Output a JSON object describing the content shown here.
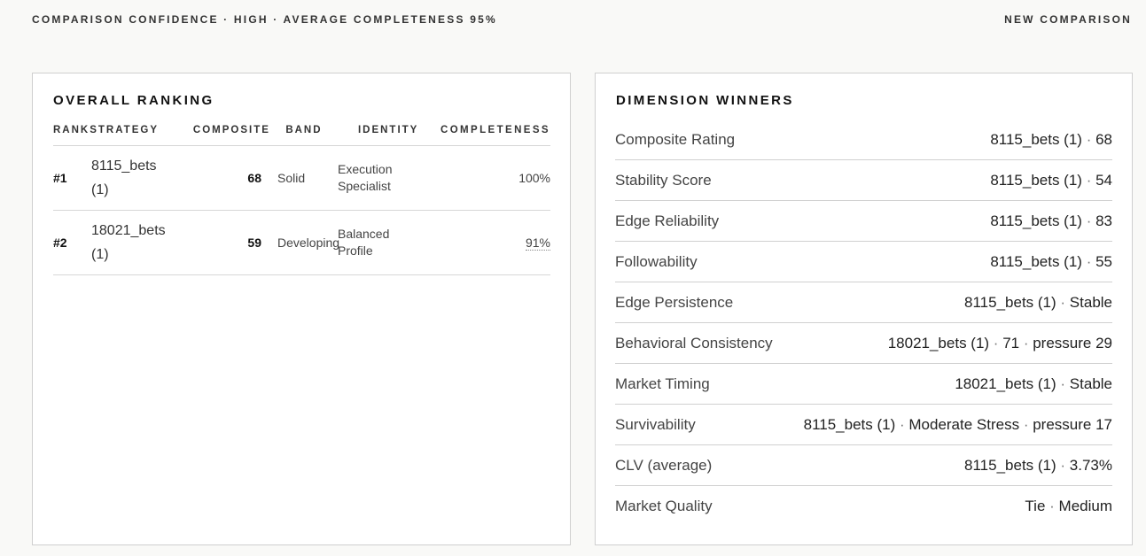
{
  "header": {
    "confidence_text": "COMPARISON CONFIDENCE · HIGH · AVERAGE COMPLETENESS 95%",
    "new_comparison_label": "NEW COMPARISON"
  },
  "ranking": {
    "title": "OVERALL RANKING",
    "columns": {
      "rank": "RANK",
      "strategy": "STRATEGY",
      "composite": "COMPOSITE",
      "band": "BAND",
      "identity": "IDENTITY",
      "completeness": "COMPLETENESS"
    },
    "rows": [
      {
        "rank": "#1",
        "strategy_line1": "8115_bets",
        "strategy_line2": "(1)",
        "composite": "68",
        "band": "Solid",
        "identity_line1": "Execution",
        "identity_line2": "Specialist",
        "completeness": "100%"
      },
      {
        "rank": "#2",
        "strategy_line1": "18021_bets",
        "strategy_line2": "(1)",
        "composite": "59",
        "band": "Developing",
        "identity_line1": "Balanced",
        "identity_line2": "Profile",
        "completeness": "91%"
      }
    ]
  },
  "winners": {
    "title": "DIMENSION WINNERS",
    "rows": [
      {
        "label": "Composite Rating",
        "value": "8115_bets (1)",
        "detail": "68"
      },
      {
        "label": "Stability Score",
        "value": "8115_bets (1)",
        "detail": "54"
      },
      {
        "label": "Edge Reliability",
        "value": "8115_bets (1)",
        "detail": "83"
      },
      {
        "label": "Followability",
        "value": "8115_bets (1)",
        "detail": "55"
      },
      {
        "label": "Edge Persistence",
        "value": "8115_bets (1)",
        "detail": "Stable"
      },
      {
        "label": "Behavioral Consistency",
        "value": "18021_bets (1)",
        "detail": "71",
        "extra": "pressure 29"
      },
      {
        "label": "Market Timing",
        "value": "18021_bets (1)",
        "detail": "Stable"
      },
      {
        "label": "Survivability",
        "value": "8115_bets (1)",
        "detail": "Moderate Stress",
        "extra": "pressure 17"
      },
      {
        "label": "CLV (average)",
        "value": "8115_bets (1)",
        "detail": "3.73%"
      },
      {
        "label": "Market Quality",
        "value": "Tie",
        "detail": "Medium"
      }
    ]
  }
}
